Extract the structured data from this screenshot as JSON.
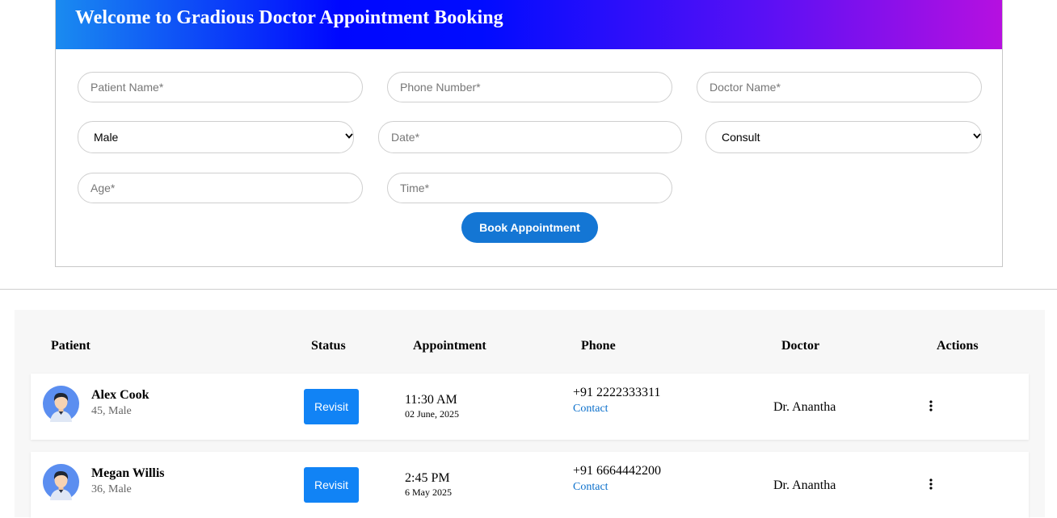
{
  "header": {
    "title": "Welcome to Gradious Doctor Appointment Booking"
  },
  "form": {
    "patient_name": {
      "placeholder": "Patient Name*"
    },
    "phone_number": {
      "placeholder": "Phone Number*"
    },
    "doctor_name": {
      "placeholder": "Doctor Name*"
    },
    "gender": {
      "value": "Male"
    },
    "date": {
      "placeholder": "Date*"
    },
    "type": {
      "value": "Consult"
    },
    "age": {
      "placeholder": "Age*"
    },
    "time": {
      "placeholder": "Time*"
    },
    "submit_label": "Book Appointment"
  },
  "table": {
    "columns": [
      "Patient",
      "Status",
      "Appointment",
      "Phone",
      "Doctor",
      "Actions"
    ],
    "rows": [
      {
        "name": "Alex Cook",
        "meta": "45, Male",
        "status": "Revisit",
        "time": "11:30 AM",
        "date": "02 June, 2025",
        "phone": "+91 2222333311",
        "contact": "Contact",
        "doctor": "Dr. Anantha"
      },
      {
        "name": "Megan Willis",
        "meta": "36, Male",
        "status": "Revisit",
        "time": "2:45 PM",
        "date": "6 May 2025",
        "phone": "+91 6664442200",
        "contact": "Contact",
        "doctor": "Dr. Anantha"
      }
    ]
  },
  "icons": {
    "avatar": "user-avatar-icon",
    "actions": "kebab-menu-icon",
    "select": "chevron-down-icon"
  },
  "colors": {
    "primary": "#1476d4",
    "status_button": "#1183f5",
    "link": "#0a6fcb",
    "banner_start": "#1a8bf0",
    "banner_end": "#b610e0"
  }
}
